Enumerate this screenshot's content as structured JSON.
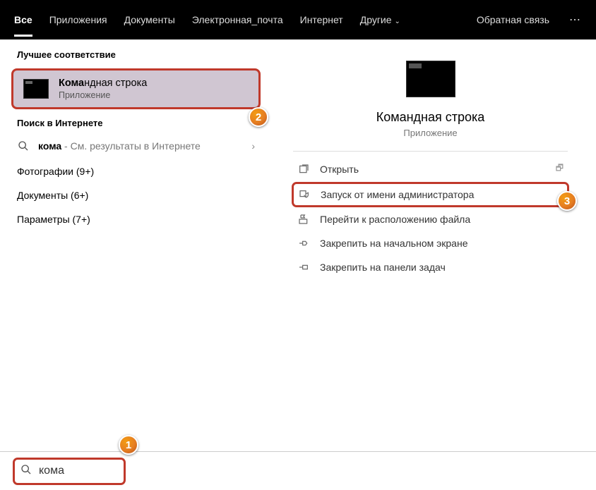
{
  "topbar": {
    "tabs": [
      "Все",
      "Приложения",
      "Документы",
      "Электронная_почта",
      "Интернет",
      "Другие"
    ],
    "feedback": "Обратная связь"
  },
  "left": {
    "best_match_header": "Лучшее соответствие",
    "best_match_title_prefix": "Кома",
    "best_match_title_rest": "ндная строка",
    "best_match_sub": "Приложение",
    "internet_header": "Поиск в Интернете",
    "internet_query": "кома",
    "internet_suffix": " - См. результаты в Интернете",
    "cat_photos": "Фотографии (9+)",
    "cat_docs": "Документы (6+)",
    "cat_params": "Параметры (7+)"
  },
  "right": {
    "title": "Командная строка",
    "sub": "Приложение",
    "actions": {
      "open": "Открыть",
      "run_admin": "Запуск от имени администратора",
      "open_location": "Перейти к расположению файла",
      "pin_start": "Закрепить на начальном экране",
      "pin_taskbar": "Закрепить на панели задач"
    }
  },
  "search": {
    "value": "кома"
  },
  "annotations": {
    "b1": "1",
    "b2": "2",
    "b3": "3"
  }
}
